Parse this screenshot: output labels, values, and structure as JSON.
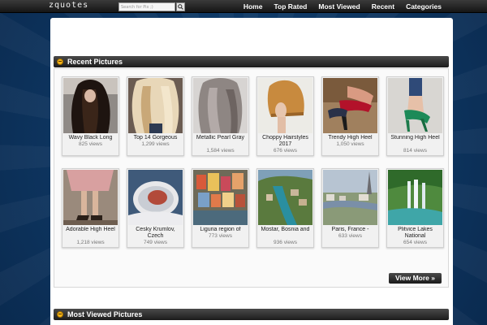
{
  "site": {
    "logo": "zquotes"
  },
  "search": {
    "placeholder": "Search for Pix ;)"
  },
  "nav": [
    "Home",
    "Top Rated",
    "Most Viewed",
    "Recent",
    "Categories"
  ],
  "sections": {
    "recent": "Recent Pictures",
    "most_viewed": "Most Viewed Pictures",
    "view_more": "View More »"
  },
  "pictures": [
    {
      "title": "Wavy Black Long",
      "views": "825 views"
    },
    {
      "title": "Top 14 Gorgeous",
      "views": "1,299 views"
    },
    {
      "title": "Metallic Pearl Gray",
      "views": "1,584 views"
    },
    {
      "title": "Choppy Hairstyles 2017",
      "views": "676 views"
    },
    {
      "title": "Trendy High Heel",
      "views": "1,050 views"
    },
    {
      "title": "Stunning High Heel",
      "views": "814 views"
    },
    {
      "title": "Adorable High Heel",
      "views": "1,218 views"
    },
    {
      "title": "Cesky Krumlov, Czech",
      "views": "749 views"
    },
    {
      "title": "Liguria region of",
      "views": "773 views"
    },
    {
      "title": "Mostar, Bosnia and",
      "views": "936 views"
    },
    {
      "title": "Paris, France -",
      "views": "633 views"
    },
    {
      "title": "Plitvice Lakes National",
      "views": "654 views"
    }
  ]
}
